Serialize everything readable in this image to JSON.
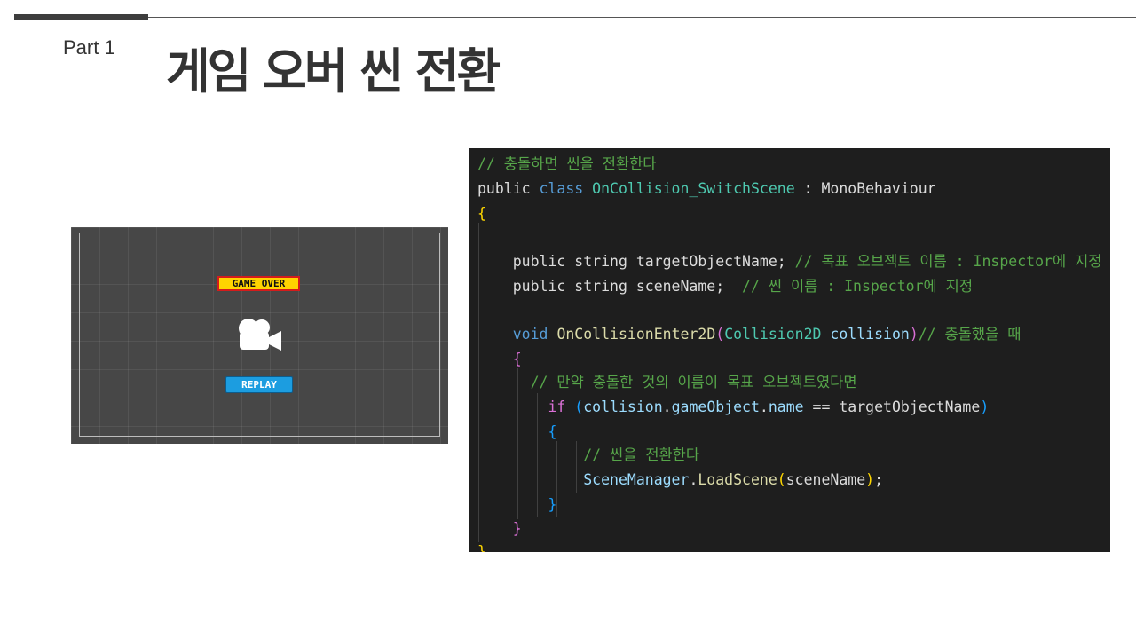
{
  "slide": {
    "part_label": "Part 1",
    "title": "게임 오버 씬 전환"
  },
  "scene_preview": {
    "game_over_label": "GAME OVER",
    "replay_label": "REPLAY",
    "camera_icon": "video-camera-icon"
  },
  "code": {
    "l1_comment": "// 충돌하면 씬을 전환한다",
    "l2_public": "public",
    "l2_class": "class",
    "l2_name": "OnCollision_SwitchScene",
    "l2_colon": " : ",
    "l2_base": "MonoBehaviour",
    "l3_brace": "{",
    "l5_decl": "public string targetObjectName;",
    "l5_comment": " // 목표 오브젝트 이름 : Inspector에 지정",
    "l6_decl": "public string sceneName;",
    "l6_comment": "  // 씬 이름 : Inspector에 지정",
    "l8_void": "void",
    "l8_method": "OnCollisionEnter2D",
    "l8_paren_open": "(",
    "l8_type": "Collision2D",
    "l8_param": "collision",
    "l8_paren_close": ")",
    "l8_comment": "// 충돌했을 때",
    "l9_brace": "{",
    "l10_comment": "// 만약 충돌한 것의 이름이 목표 오브젝트였다면",
    "l11_if": "if",
    "l11_paren_open": "(",
    "l11_expr1": "collision",
    "l11_dot1": ".",
    "l11_expr2": "gameObject",
    "l11_dot2": ".",
    "l11_expr3": "name",
    "l11_op": " == ",
    "l11_rhs": "targetObjectName",
    "l11_paren_close": ")",
    "l12_brace": "{",
    "l13_comment": "// 씬을 전환한다",
    "l14_class": "SceneManager",
    "l14_dot": ".",
    "l14_method": "LoadScene",
    "l14_paren_open": "(",
    "l14_arg": "sceneName",
    "l14_paren_close": ")",
    "l14_semi": ";",
    "l15_brace": "}",
    "l16_brace": "}",
    "l17_brace": "}"
  }
}
